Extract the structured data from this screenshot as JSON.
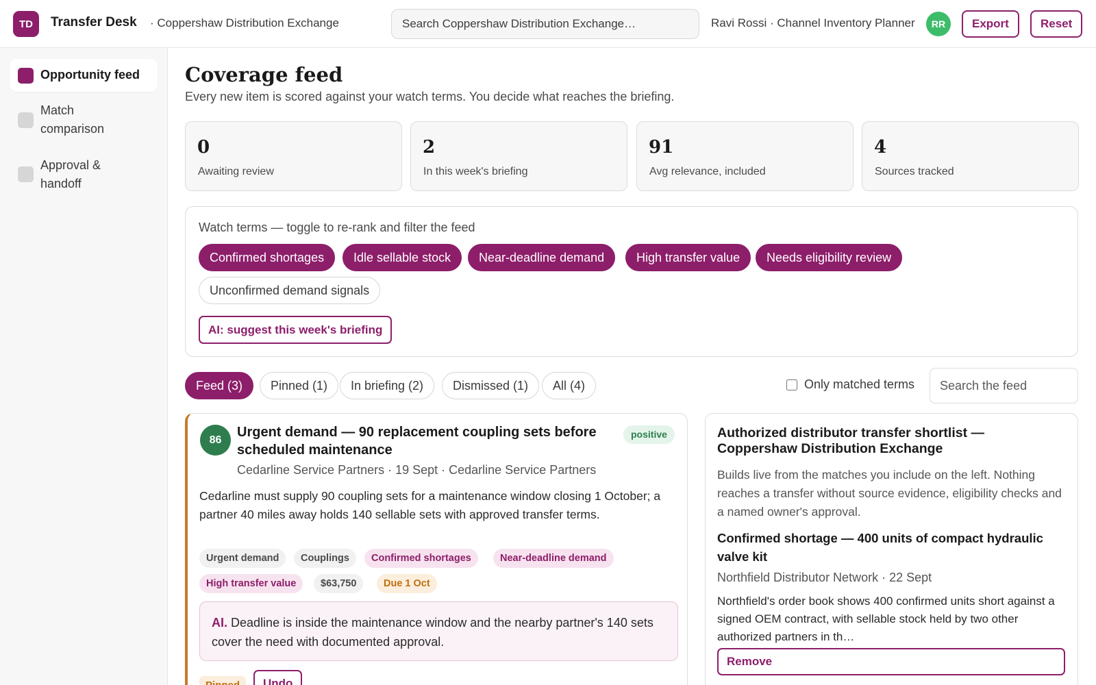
{
  "header": {
    "logo_text": "TD",
    "app_title": "Transfer Desk",
    "org_name": "· Coppershaw Distribution Exchange",
    "search_placeholder": "Search Coppershaw Distribution Exchange…",
    "user_label": "Ravi Rossi · Channel Inventory Planner",
    "avatar_initials": "RR",
    "export_label": "Export",
    "reset_label": "Reset"
  },
  "sidebar": {
    "items": [
      {
        "label": "Opportunity feed",
        "active": true
      },
      {
        "label": "Match comparison",
        "active": false
      },
      {
        "label": "Approval & handoff",
        "active": false
      }
    ]
  },
  "main": {
    "title": "Coverage feed",
    "subtitle": "Every new item is scored against your watch terms. You decide what reaches the briefing."
  },
  "stats": [
    {
      "value": "0",
      "label": "Awaiting review"
    },
    {
      "value": "2",
      "label": "In this week's briefing"
    },
    {
      "value": "91",
      "label": "Avg relevance, included"
    },
    {
      "value": "4",
      "label": "Sources tracked"
    }
  ],
  "watch_terms": {
    "label": "Watch terms — toggle to re-rank and filter the feed",
    "terms": [
      {
        "label": "Confirmed shortages",
        "on": true
      },
      {
        "label": "Idle sellable stock",
        "on": true
      },
      {
        "label": "Near-deadline demand",
        "on": true
      },
      {
        "label": "High transfer value",
        "on": true
      },
      {
        "label": "Needs eligibility review",
        "on": true
      },
      {
        "label": "Unconfirmed demand signals",
        "on": false
      }
    ],
    "ai_button": "AI: suggest this week's briefing"
  },
  "tabs": [
    {
      "label": "Feed (3)",
      "active": true
    },
    {
      "label": "Pinned (1)",
      "active": false
    },
    {
      "label": "In briefing (2)",
      "active": false
    },
    {
      "label": "Dismissed (1)",
      "active": false
    },
    {
      "label": "All (4)",
      "active": false
    }
  ],
  "filters": {
    "only_matched_label": "Only matched terms",
    "only_matched_checked": false,
    "search_placeholder": "Search the feed"
  },
  "feed_card": {
    "score": "86",
    "title": "Urgent demand — 90 replacement coupling sets before scheduled maintenance",
    "sentiment": "positive",
    "meta": "Cedarline Service Partners · 19 Sept · Cedarline Service Partners",
    "body": "Cedarline must supply 90 coupling sets for a maintenance window closing 1 October; a partner 40 miles away holds 140 sellable sets with approved transfer terms.",
    "tags": [
      {
        "label": "Urgent demand",
        "kind": "grey"
      },
      {
        "label": "Couplings",
        "kind": "grey"
      },
      {
        "label": "Confirmed shortages",
        "kind": "match"
      },
      {
        "label": "Near-deadline demand",
        "kind": "match"
      },
      {
        "label": "High transfer value",
        "kind": "match"
      },
      {
        "label": "$63,750",
        "kind": "grey"
      },
      {
        "label": "Due 1 Oct",
        "kind": "due"
      }
    ],
    "ai_prefix": "AI.",
    "ai_text": "Deadline is inside the maintenance window and the nearby partner's 140 sets cover the need with documented approval.",
    "status_label": "Pinned",
    "undo_label": "Undo",
    "accent_color": "#c77b2a"
  },
  "shortlist": {
    "title": "Authorized distributor transfer shortlist — Coppershaw Distribution Exchange",
    "description": "Builds live from the matches you include on the left. Nothing reaches a transfer without source evidence, eligibility checks and a named owner's approval.",
    "item": {
      "title": "Confirmed shortage — 400 units of compact hydraulic valve kit",
      "meta": "Northfield Distributor Network · 22 Sept",
      "body": "Northfield's order book shows 400 confirmed units short against a signed OEM contract, with sellable stock held by two other authorized partners in th…",
      "remove_label": "Remove"
    }
  },
  "colors": {
    "brand": "#8d1e6a",
    "score_green": "#2e7d4e",
    "avatar_green": "#3dbc6a",
    "due_orange": "#c06f12"
  },
  "icons": [
    "nav-square-icon"
  ]
}
